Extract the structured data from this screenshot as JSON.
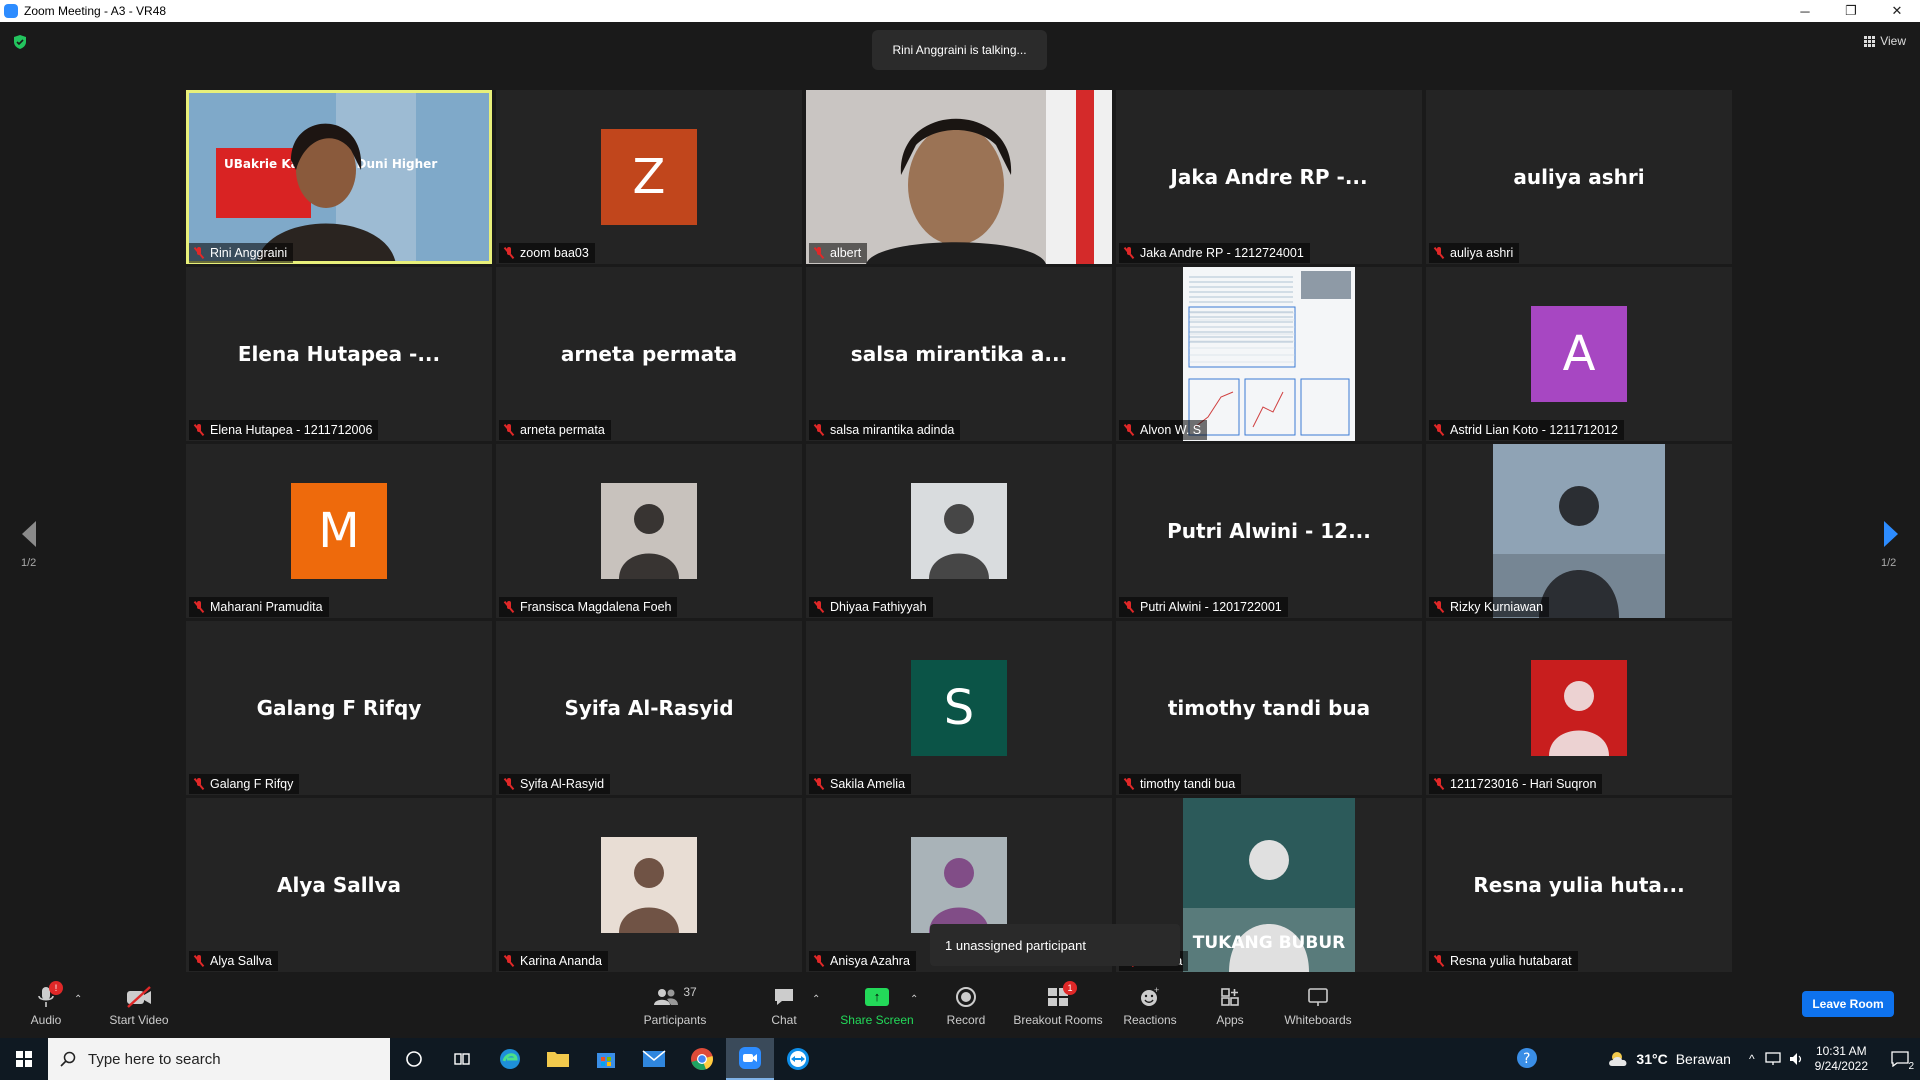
{
  "window": {
    "title": "Zoom Meeting - A3 - VR48",
    "minimize": "─",
    "restore": "❐",
    "close": "✕"
  },
  "header": {
    "talking": "Rini Anggraini is talking...",
    "view_label": "View"
  },
  "pager": {
    "left": "1/2",
    "right": "1/2"
  },
  "tiles": [
    {
      "type": "video",
      "name": "Rini Anggraini",
      "active": true,
      "sign_text": "UBakrie Kampus di Duni Higher"
    },
    {
      "type": "avatar",
      "name": "zoom baa03",
      "initial": "Z",
      "color": "#c1461c"
    },
    {
      "type": "video",
      "name": "albert"
    },
    {
      "type": "text",
      "name": "Jaka Andre RP - 1212724001",
      "display": "Jaka Andre RP -..."
    },
    {
      "type": "text",
      "name": "auliya ashri",
      "display": "auliya ashri"
    },
    {
      "type": "text",
      "name": "Elena Hutapea - 1211712006",
      "display": "Elena Hutapea -..."
    },
    {
      "type": "text",
      "name": "arneta permata",
      "display": "arneta permata"
    },
    {
      "type": "text",
      "name": "salsa mirantika adinda",
      "display": "salsa mirantika a..."
    },
    {
      "type": "doc",
      "name": "Alvon W. S"
    },
    {
      "type": "avatar",
      "name": "Astrid Lian Koto - 1211712012",
      "initial": "A",
      "color": "#a747c2"
    },
    {
      "type": "avatar",
      "name": "Maharani Pramudita",
      "initial": "M",
      "color": "#ee6a0c"
    },
    {
      "type": "photo",
      "name": "Fransisca Magdalena Foeh",
      "bg": "#c8c2bd",
      "fg": "#1e1b1a"
    },
    {
      "type": "photo",
      "name": "Dhiyaa Fathiyyah",
      "bg": "#d9dcde",
      "fg": "#2b2b2b"
    },
    {
      "type": "text",
      "name": "Putri Alwini - 1201722001",
      "display": "Putri Alwini - 12..."
    },
    {
      "type": "tallphoto",
      "name": "Rizky Kurniawan",
      "bg": "#8fa3b5",
      "fg": "#2b2e33"
    },
    {
      "type": "text",
      "name": "Galang F Rifqy",
      "display": "Galang F Rifqy"
    },
    {
      "type": "text",
      "name": "Syifa Al-Rasyid",
      "display": "Syifa Al-Rasyid"
    },
    {
      "type": "avatar",
      "name": "Sakila Amelia",
      "initial": "S",
      "color": "#0b5447"
    },
    {
      "type": "text",
      "name": "timothy tandi bua",
      "display": "timothy tandi bua"
    },
    {
      "type": "photo",
      "name": "1211723016 - Hari Suqron",
      "bg": "#c81e1e",
      "fg": "#f2f2f2"
    },
    {
      "type": "text",
      "name": "Alya Sallva",
      "display": "Alya Sallva"
    },
    {
      "type": "photo",
      "name": "Karina Ananda",
      "bg": "#e8ddd4",
      "fg": "#5a3b2b"
    },
    {
      "type": "photo",
      "name": "Anisya Azahra",
      "bg": "#a9b3b8",
      "fg": "#7a3b7e"
    },
    {
      "type": "tallphoto",
      "name": "ermana",
      "bg": "#2c5a5a",
      "fg": "#e0e0e0",
      "poster_text": "TUKANG BUBUR"
    },
    {
      "type": "text",
      "name": "Resna yulia hutabarat",
      "display": "Resna yulia huta..."
    }
  ],
  "popup": {
    "text": "1 unassigned participant"
  },
  "toolbar": {
    "audio": "Audio",
    "audio_badge": "!",
    "start_video": "Start Video",
    "participants": "Participants",
    "participants_count": "37",
    "chat": "Chat",
    "share_screen": "Share Screen",
    "record": "Record",
    "breakout_rooms": "Breakout Rooms",
    "breakout_badge": "1",
    "reactions": "Reactions",
    "apps": "Apps",
    "whiteboards": "Whiteboards",
    "leave": "Leave Room"
  },
  "taskbar": {
    "search_placeholder": "Type here to search",
    "weather": "31°C",
    "weather_desc": "Berawan",
    "time": "10:31 AM",
    "date": "9/24/2022",
    "notif_count": "2"
  },
  "colors": {
    "accent": "#0e72ed",
    "share_green": "#23d959",
    "muted_red": "#e02828",
    "active_outline": "#e8f07a"
  }
}
